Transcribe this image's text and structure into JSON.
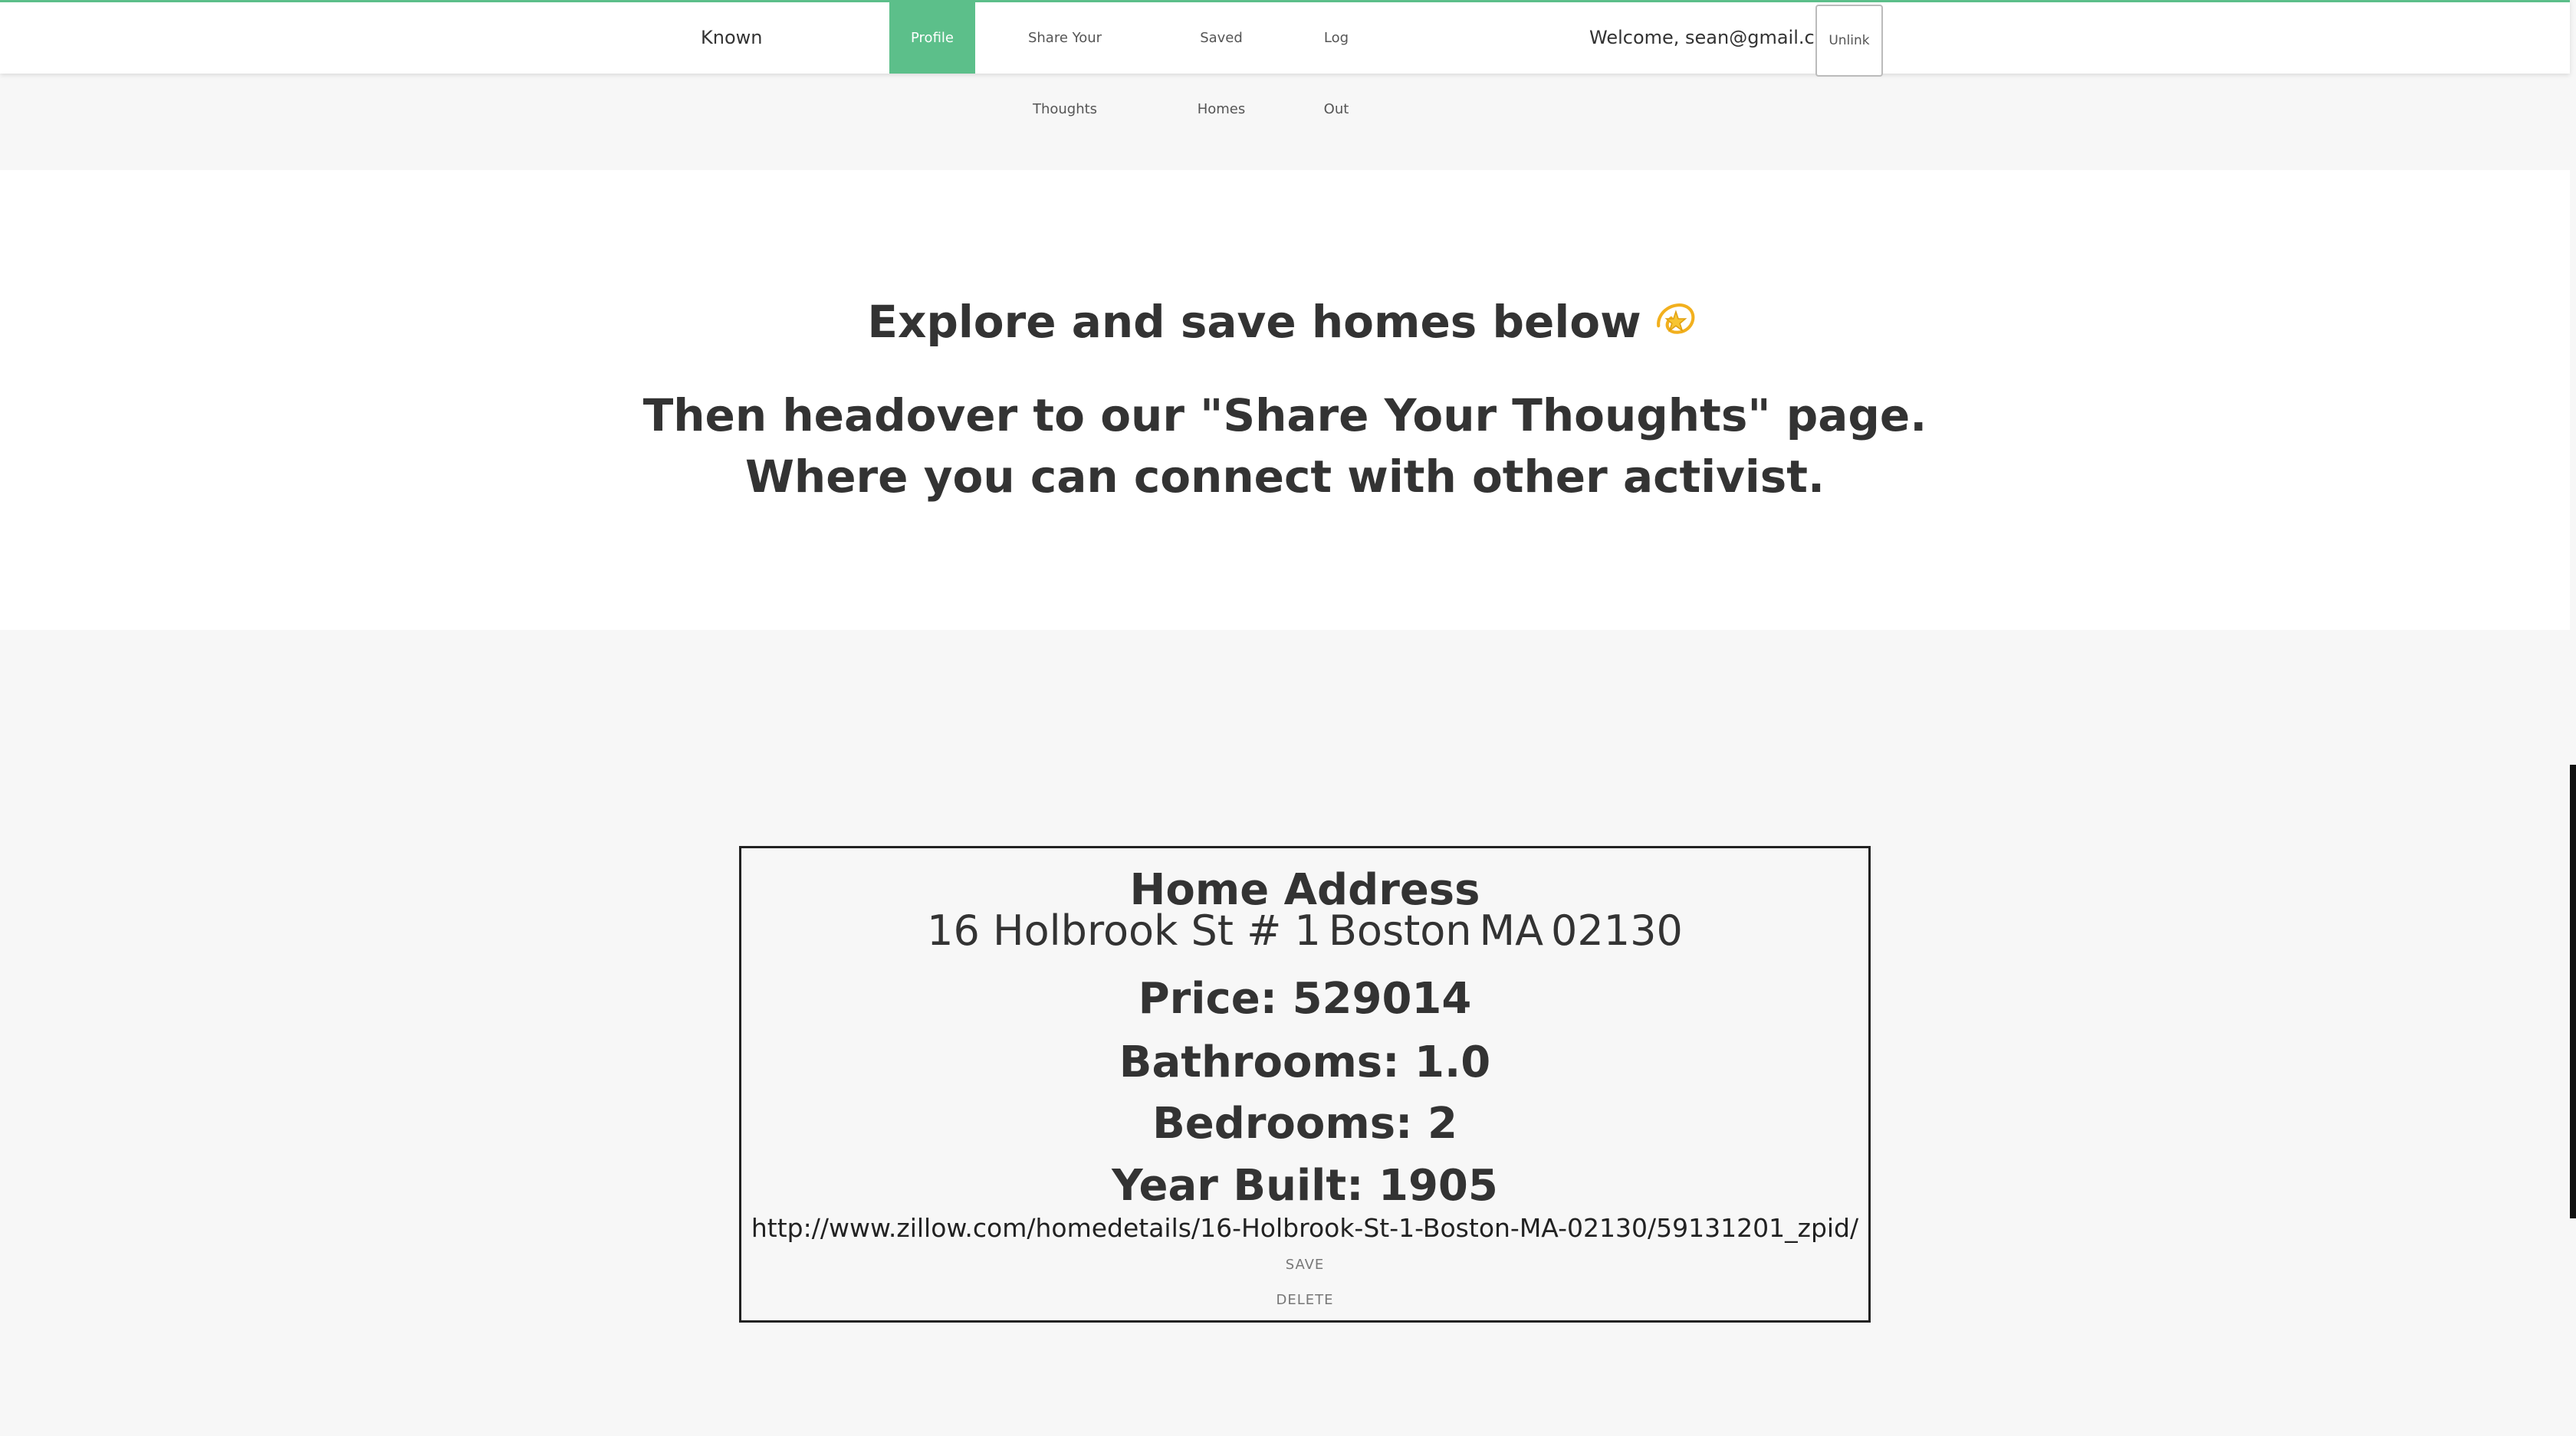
{
  "navbar": {
    "brand": "Known",
    "items": [
      {
        "label": "Profile"
      },
      {
        "label": "Share Your Thoughts"
      },
      {
        "label": "Saved Homes"
      },
      {
        "label": "Log Out"
      }
    ],
    "welcome": "Welcome, sean@gmail.com",
    "unlink_label": "Unlink",
    "accent_color": "#5cbf8a"
  },
  "hero": {
    "title": "Explore and save homes below",
    "title_icon": "dizzy-star-icon",
    "subtitle_line1": "Then headover to our \"Share Your Thoughts\" page.",
    "subtitle_line2": "Where you can connect with other activist."
  },
  "home": {
    "heading": "Home Address",
    "street": "16 Holbrook St # 1",
    "city": "Boston",
    "state": "MA",
    "zip": "02130",
    "price": "Price: 529014",
    "bathrooms": "Bathrooms: 1.0",
    "bedrooms": "Bedrooms: 2",
    "year_built": "Year Built: 1905",
    "url": "http://www.zillow.com/homedetails/16-Holbrook-St-1-Boston-MA-02130/59131201_zpid/",
    "save_label": "SAVE",
    "delete_label": "DELETE"
  }
}
